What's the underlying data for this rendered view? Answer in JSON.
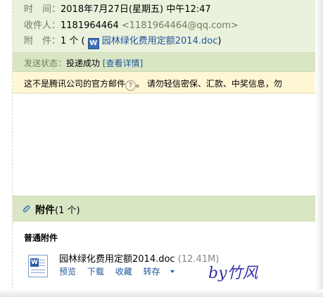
{
  "header": {
    "time_label": "时　间：",
    "time_value": "2018年7月27日(星期五) 中午12:47",
    "to_label": "收件人：",
    "to_name": "1181964464",
    "to_email": "<1181964464@qq.com>",
    "att_label": "附　件：",
    "att_count": "1 个 (",
    "att_file": "园林绿化费用定额2014.doc",
    "att_close": ")"
  },
  "status": {
    "label": "发送状态：",
    "value": "投递成功",
    "details": "[查看详情]"
  },
  "warning": {
    "text_before": "这不是腾讯公司的官方邮件",
    "help": "?",
    "text_after": "。 请勿轻信密保、汇款、中奖信息，勿"
  },
  "attachments": {
    "title": "附件",
    "count": "(1 个)",
    "section": "普通附件",
    "file_name": "园林绿化费用定额2014.doc",
    "file_size": "(12.41M)",
    "actions": {
      "preview": "预览",
      "download": "下载",
      "favorite": "收藏",
      "forward": "转存"
    }
  },
  "watermark": "by竹风",
  "colors": {
    "header_bg": "#eaf1dc",
    "status_bg": "#d9e6c4",
    "warning_bg": "#fff6d4",
    "link": "#21559b"
  }
}
